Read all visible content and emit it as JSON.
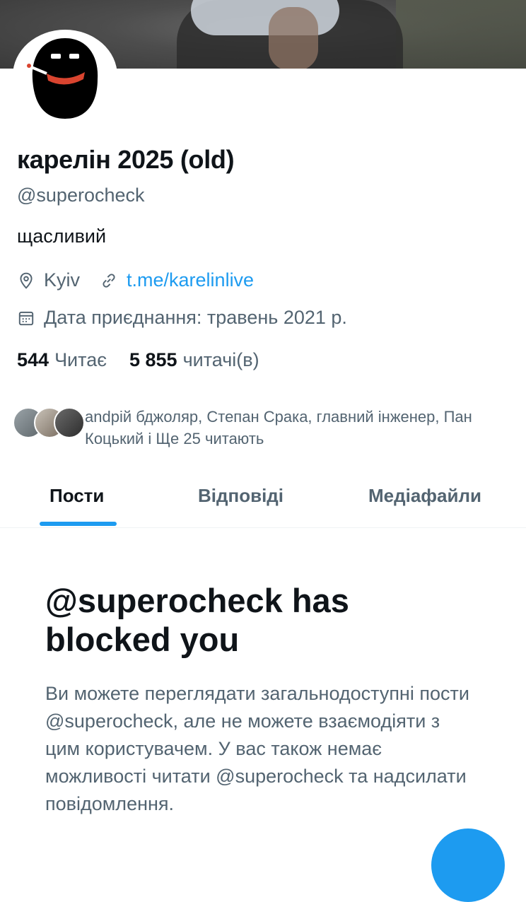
{
  "profile": {
    "name": "карелін 2025 (old)",
    "handle": "@superocheck",
    "bio": "щасливий",
    "location": "Kyiv",
    "link": "t.me/karelinlive",
    "joined": "Дата приєднання: травень 2021 р."
  },
  "stats": {
    "following_count": "544",
    "following_label": "Читає",
    "followers_count": "5 855",
    "followers_label": "читачі(в)"
  },
  "followers_known": {
    "text": "аndрій бджоляр, Степан Срака, главний інженер, Пан Коцький і Ще 25 читають"
  },
  "tabs": [
    "Пости",
    "Відповіді",
    "Медіафайли"
  ],
  "blocked": {
    "title": "@superocheck has blocked you",
    "text": "Ви можете переглядати загальнодоступні пости @superocheck, але не можете взаємодіяти з цим користувачем. У вас також немає можливості читати @superocheck та надсилати повідомлення."
  },
  "icons": {
    "location": "location-pin-icon",
    "link": "link-icon",
    "calendar": "calendar-icon"
  },
  "colors": {
    "accent": "#1d9bf0",
    "secondary_text": "#536471",
    "primary_text": "#0f1419"
  }
}
